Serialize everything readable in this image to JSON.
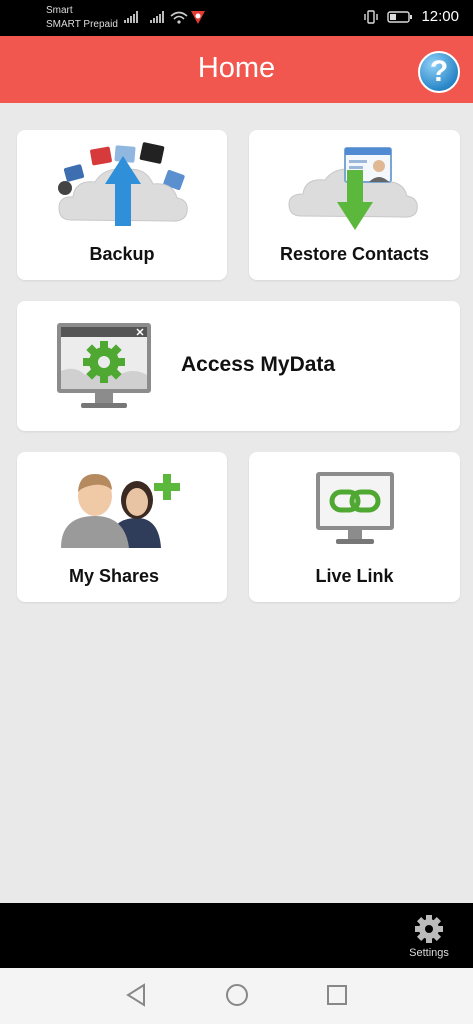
{
  "status_bar": {
    "carrier_line1": "Smart",
    "carrier_line2": "SMART Prepaid",
    "time": "12:00"
  },
  "header": {
    "title": "Home",
    "help_label": "?"
  },
  "cards": {
    "backup": "Backup",
    "restore_contacts": "Restore Contacts",
    "access_mydata": "Access MyData",
    "my_shares": "My Shares",
    "live_link": "Live Link"
  },
  "bottom_bar": {
    "settings_label": "Settings"
  },
  "colors": {
    "header": "#f2574f",
    "background": "#e9e9e9",
    "arrow_up": "#2f8fd8",
    "arrow_down": "#5cb83c",
    "plus": "#5cb83c"
  },
  "icons": {
    "backup": "cloud-upload-icon",
    "restore": "cloud-download-icon",
    "access": "monitor-gear-icon",
    "shares": "people-plus-icon",
    "livelink": "monitor-link-icon",
    "settings": "gear-icon",
    "back": "triangle-back-icon",
    "home": "circle-home-icon",
    "recents": "square-recents-icon"
  }
}
